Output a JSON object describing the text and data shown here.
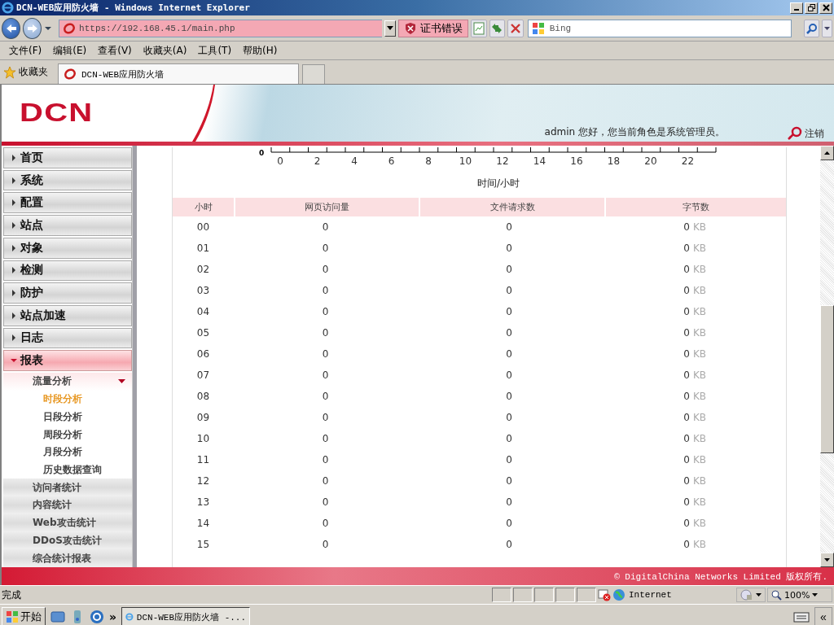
{
  "window": {
    "title": "DCN-WEB应用防火墙 - Windows Internet Explorer"
  },
  "address_bar": {
    "value": "https://192.168.45.1/main.php"
  },
  "certificate_error": "证书错误",
  "search": {
    "placeholder": "Bing"
  },
  "menu": [
    "文件(F)",
    "编辑(E)",
    "查看(V)",
    "收藏夹(A)",
    "工具(T)",
    "帮助(H)"
  ],
  "favorites": {
    "label": "收藏夹",
    "tabs": [
      {
        "label": "DCN-WEB应用防火墙",
        "selected": true
      }
    ]
  },
  "header": {
    "logo": "DCN",
    "greeting": "admin 您好，您当前角色是系统管理员。",
    "logout": "注销"
  },
  "sidebar": {
    "items": [
      {
        "label": "首页",
        "expanded": false
      },
      {
        "label": "系统",
        "expanded": false
      },
      {
        "label": "配置",
        "expanded": false
      },
      {
        "label": "站点",
        "expanded": false
      },
      {
        "label": "对象",
        "expanded": false
      },
      {
        "label": "检测",
        "expanded": false
      },
      {
        "label": "防护",
        "expanded": false
      },
      {
        "label": "站点加速",
        "expanded": false
      },
      {
        "label": "日志",
        "expanded": false
      },
      {
        "label": "报表",
        "expanded": true,
        "children": [
          {
            "label": "流量分析",
            "expanded": true,
            "children": [
              {
                "label": "时段分析",
                "selected": true
              },
              {
                "label": "日段分析",
                "selected": false
              },
              {
                "label": "周段分析",
                "selected": false
              },
              {
                "label": "月段分析",
                "selected": false
              },
              {
                "label": "历史数据查询",
                "selected": false
              }
            ]
          },
          {
            "label": "访问者统计",
            "expanded": false
          },
          {
            "label": "内容统计",
            "expanded": false
          },
          {
            "label": "Web攻击统计",
            "expanded": false
          },
          {
            "label": "DDoS攻击统计",
            "expanded": false
          },
          {
            "label": "综合统计报表",
            "expanded": false
          }
        ]
      }
    ]
  },
  "axis": {
    "y_label": "0",
    "x_ticks": [
      "0",
      "2",
      "4",
      "6",
      "8",
      "10",
      "12",
      "14",
      "16",
      "18",
      "20",
      "22"
    ],
    "x_title": "时间/小时"
  },
  "table": {
    "columns": [
      "小时",
      "网页访问量",
      "文件请求数",
      "字节数"
    ],
    "rows": [
      {
        "hour": "00",
        "page_views": "0",
        "file_requests": "0",
        "bytes": "0",
        "unit": "KB"
      },
      {
        "hour": "01",
        "page_views": "0",
        "file_requests": "0",
        "bytes": "0",
        "unit": "KB"
      },
      {
        "hour": "02",
        "page_views": "0",
        "file_requests": "0",
        "bytes": "0",
        "unit": "KB"
      },
      {
        "hour": "03",
        "page_views": "0",
        "file_requests": "0",
        "bytes": "0",
        "unit": "KB"
      },
      {
        "hour": "04",
        "page_views": "0",
        "file_requests": "0",
        "bytes": "0",
        "unit": "KB"
      },
      {
        "hour": "05",
        "page_views": "0",
        "file_requests": "0",
        "bytes": "0",
        "unit": "KB"
      },
      {
        "hour": "06",
        "page_views": "0",
        "file_requests": "0",
        "bytes": "0",
        "unit": "KB"
      },
      {
        "hour": "07",
        "page_views": "0",
        "file_requests": "0",
        "bytes": "0",
        "unit": "KB"
      },
      {
        "hour": "08",
        "page_views": "0",
        "file_requests": "0",
        "bytes": "0",
        "unit": "KB"
      },
      {
        "hour": "09",
        "page_views": "0",
        "file_requests": "0",
        "bytes": "0",
        "unit": "KB"
      },
      {
        "hour": "10",
        "page_views": "0",
        "file_requests": "0",
        "bytes": "0",
        "unit": "KB"
      },
      {
        "hour": "11",
        "page_views": "0",
        "file_requests": "0",
        "bytes": "0",
        "unit": "KB"
      },
      {
        "hour": "12",
        "page_views": "0",
        "file_requests": "0",
        "bytes": "0",
        "unit": "KB"
      },
      {
        "hour": "13",
        "page_views": "0",
        "file_requests": "0",
        "bytes": "0",
        "unit": "KB"
      },
      {
        "hour": "14",
        "page_views": "0",
        "file_requests": "0",
        "bytes": "0",
        "unit": "KB"
      },
      {
        "hour": "15",
        "page_views": "0",
        "file_requests": "0",
        "bytes": "0",
        "unit": "KB"
      }
    ]
  },
  "footer": "© DigitalChina Networks Limited 版权所有.",
  "status_bar": {
    "text": "完成",
    "zone": "Internet",
    "zoom": "100%"
  },
  "taskbar": {
    "start": "开始",
    "more": "»",
    "task": "DCN-WEB应用防火墙 -...",
    "collapse": "«"
  }
}
